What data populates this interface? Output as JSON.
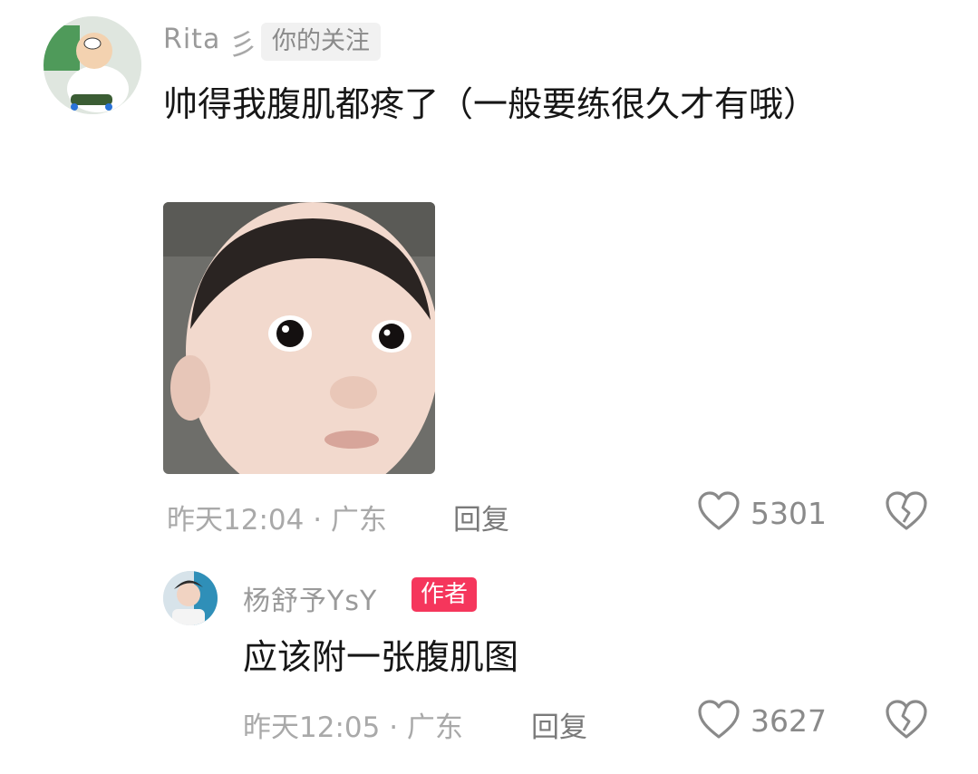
{
  "comment": {
    "user_name": "Rita",
    "user_badge_glyph": "彡",
    "follow_tag": "你的关注",
    "text": "帅得我腹肌都疼了（一般要练很久才有哦）",
    "meta": "昨天12:04 · 广东",
    "reply_label": "回复",
    "like_count": "5301",
    "icons": {
      "like": "heart-outline-icon",
      "dislike": "broken-heart-icon"
    }
  },
  "reply": {
    "user_name": "杨舒予YsY",
    "author_tag": "作者",
    "text": "应该附一张腹肌图",
    "meta": "昨天12:05 · 广东",
    "reply_label": "回复",
    "like_count": "3627",
    "icons": {
      "like": "heart-outline-icon",
      "dislike": "broken-heart-icon"
    }
  },
  "colors": {
    "author_tag": "#f5365c",
    "secondary_text": "#a9a9a9",
    "icon": "#8a8a8a"
  }
}
